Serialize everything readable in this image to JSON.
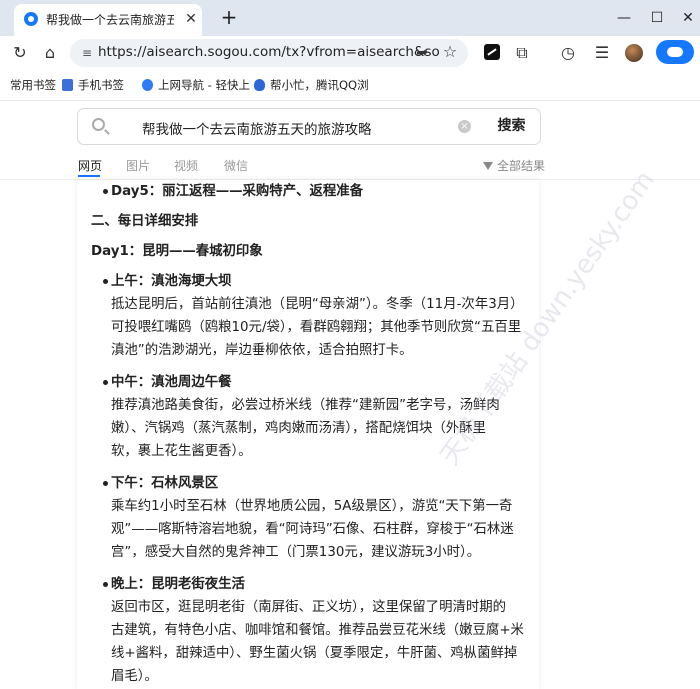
{
  "browser": {
    "tab_title": "帮我做一个去云南旅游五天的旅",
    "url": "https://aisearch.sogou.com/tx?vfrom=aisearch&so",
    "bookmarks": [
      "常用书签",
      "手机书签",
      "上网导航 - 轻快上",
      "帮小忙，腾讯QQ浏"
    ]
  },
  "search": {
    "query": "帮我做一个去云南旅游五天的旅游攻略",
    "submit_label": "搜索",
    "tabs": [
      "网页",
      "图片",
      "视频",
      "微信"
    ],
    "filter_label": "全部结果"
  },
  "content": {
    "lines": [
      "Day5：丽江返程——采购特产、返程准备",
      "二、每日详细安排",
      "Day1：昆明——春城初印象",
      "上午：滇池海埂大坝",
      "抵达昆明后，首站前往滇池（昆明“母亲湖”）。冬季（11月-次年3月）",
      "可投喂红嘴鸥（鸥粮10元/袋），看群鸥翱翔；其他季节则欣赏“五百里",
      "滇池”的浩渺湖光，岸边垂柳依依，适合拍照打卡。",
      "中午：滇池周边午餐",
      "推荐滇池路美食街，必尝过桥米线（推荐“建新园”老字号，汤鲜肉",
      "嫩）、汽锅鸡（蒸汽蒸制，鸡肉嫩而汤清），搭配烧饵块（外酥里",
      "软，裹上花生酱更香）。",
      "下午：石林风景区",
      "乘车约1小时至石林（世界地质公园，5A级景区），游览“天下第一奇",
      "观”——喀斯特溶岩地貌，看“阿诗玛”石像、石柱群，穿梭于“石林迷",
      "宫”，感受大自然的鬼斧神工（门票130元，建议游玩3小时）。",
      "晚上：昆明老街夜生活",
      "返回市区，逛昆明老街（南屏街、正义坊），这里保留了明清时期的",
      "古建筑，有特色小店、咖啡馆和餐馆。推荐品尝豆花米线（嫩豆腐+米",
      "线+酱料，甜辣适中）、野生菌火锅（夏季限定，牛肝菌、鸡枞菌鲜掉",
      "眉毛）。"
    ]
  },
  "watermark": "天极下载站 down.yesky.com",
  "colors": {
    "accent": "#1677ff",
    "tabstrip": "#dfe6ef"
  }
}
